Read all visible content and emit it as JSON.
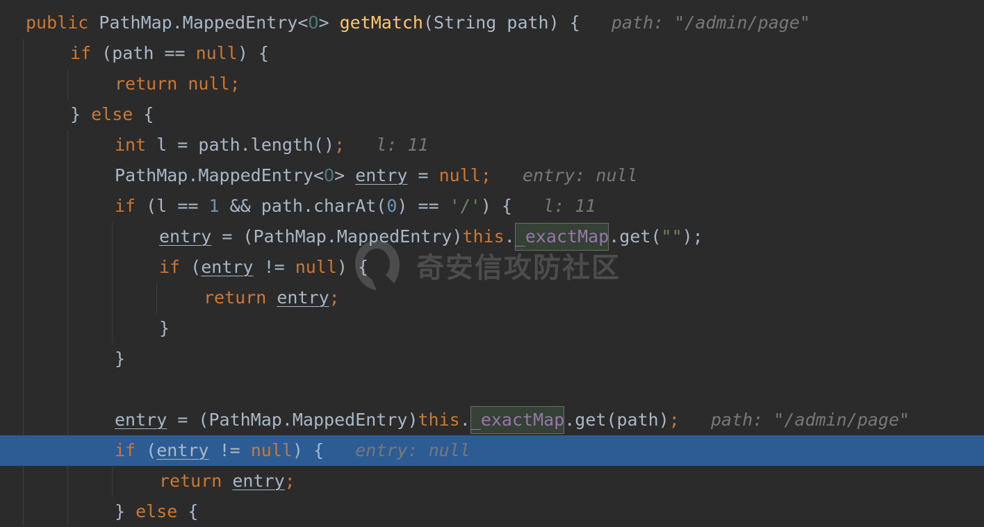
{
  "watermark": {
    "text": "奇安信攻防社区",
    "icon": "qianxin-logo-icon"
  },
  "colors": {
    "background": "#2b2b2b",
    "keyword": "#cc7832",
    "method": "#ffc66d",
    "number": "#6897bb",
    "string": "#6a8759",
    "field": "#9876aa",
    "inlay_hint": "#787878",
    "current_line": "#2d5c95"
  },
  "lines": [
    {
      "tokens": [
        {
          "t": "public",
          "c": "kw"
        },
        {
          "t": " PathMap.MappedEntry<"
        },
        {
          "t": "O",
          "c": "gen"
        },
        {
          "t": "> "
        },
        {
          "t": "getMatch",
          "c": "fn"
        },
        {
          "t": "(String path) {"
        }
      ],
      "hint": "path: \"/admin/page\""
    },
    {
      "tokens": [
        {
          "t": "if",
          "c": "kw"
        },
        {
          "t": " (path == "
        },
        {
          "t": "null",
          "c": "kw"
        },
        {
          "t": ") {"
        }
      ]
    },
    {
      "tokens": [
        {
          "t": "return null;",
          "c": "kw"
        }
      ]
    },
    {
      "tokens": [
        {
          "t": "} "
        },
        {
          "t": "else",
          "c": "kw"
        },
        {
          "t": " {"
        }
      ]
    },
    {
      "tokens": [
        {
          "t": "int",
          "c": "kw"
        },
        {
          "t": " l = path.length()"
        },
        {
          "t": ";",
          "c": "kw"
        }
      ],
      "hint": "l: 11"
    },
    {
      "tokens": [
        {
          "t": "PathMap.MappedEntry<"
        },
        {
          "t": "O",
          "c": "gen"
        },
        {
          "t": "> "
        },
        {
          "t": "entry",
          "c": "var"
        },
        {
          "t": " = "
        },
        {
          "t": "null;",
          "c": "kw"
        }
      ],
      "hint": "entry: null"
    },
    {
      "tokens": [
        {
          "t": "if",
          "c": "kw"
        },
        {
          "t": " (l == "
        },
        {
          "t": "1",
          "c": "num"
        },
        {
          "t": " && path.charAt("
        },
        {
          "t": "0",
          "c": "num"
        },
        {
          "t": ") == "
        },
        {
          "t": "'/'",
          "c": "str"
        },
        {
          "t": ") {"
        }
      ],
      "hint": "l: 11"
    },
    {
      "tokens": [
        {
          "t": "entry",
          "c": "var"
        },
        {
          "t": " = (PathMap.MappedEntry)"
        },
        {
          "t": "this",
          "c": "kw"
        },
        {
          "t": "."
        },
        {
          "t": "_exactMap",
          "c": "field hl"
        },
        {
          "t": ".get("
        },
        {
          "t": "\"\"",
          "c": "str"
        },
        {
          "t": ");"
        }
      ]
    },
    {
      "tokens": [
        {
          "t": "if",
          "c": "kw"
        },
        {
          "t": " ("
        },
        {
          "t": "entry",
          "c": "var"
        },
        {
          "t": " != "
        },
        {
          "t": "null",
          "c": "kw"
        },
        {
          "t": ") {"
        }
      ]
    },
    {
      "tokens": [
        {
          "t": "return ",
          "c": "kw"
        },
        {
          "t": "entry",
          "c": "var"
        },
        {
          "t": ";",
          "c": "kw"
        }
      ]
    },
    {
      "tokens": [
        {
          "t": "}"
        }
      ]
    },
    {
      "tokens": [
        {
          "t": "}"
        }
      ]
    },
    {
      "tokens": []
    },
    {
      "tokens": [
        {
          "t": "entry",
          "c": "var"
        },
        {
          "t": " = (PathMap.MappedEntry)"
        },
        {
          "t": "this",
          "c": "kw"
        },
        {
          "t": "."
        },
        {
          "t": "_exactMap",
          "c": "field hl"
        },
        {
          "t": ".get(path)"
        },
        {
          "t": ";",
          "c": "kw"
        }
      ],
      "hint": "path: \"/admin/page\""
    },
    {
      "tokens": [
        {
          "t": "if",
          "c": "kw"
        },
        {
          "t": " ("
        },
        {
          "t": "entry",
          "c": "var"
        },
        {
          "t": " != "
        },
        {
          "t": "null",
          "c": "kw"
        },
        {
          "t": ") {"
        }
      ],
      "hint": "entry: null",
      "current": true
    },
    {
      "tokens": [
        {
          "t": "return ",
          "c": "kw"
        },
        {
          "t": "entry",
          "c": "var"
        },
        {
          "t": ";",
          "c": "kw"
        }
      ]
    },
    {
      "tokens": [
        {
          "t": "} "
        },
        {
          "t": "else",
          "c": "kw"
        },
        {
          "t": " {"
        }
      ]
    }
  ]
}
